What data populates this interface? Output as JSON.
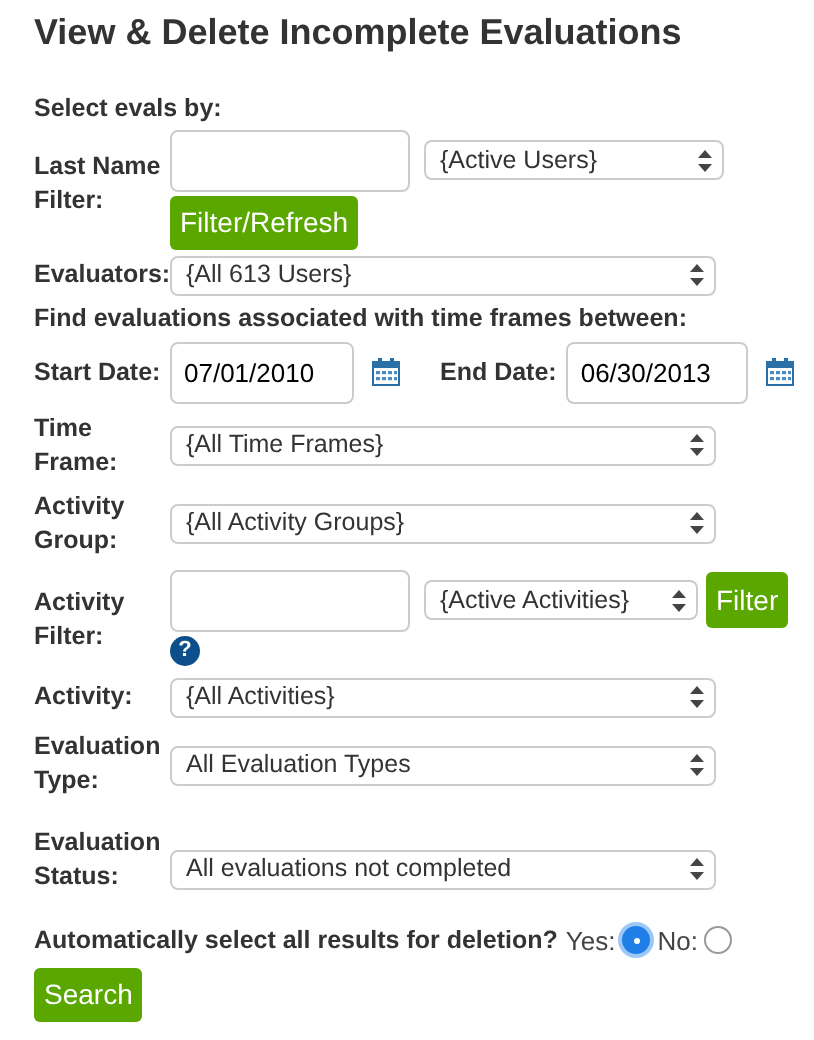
{
  "title": "View & Delete Incomplete Evaluations",
  "section_label": "Select evals by:",
  "last_name_filter": {
    "label": "Last Name Filter:",
    "users_select": "{Active Users}",
    "button": "Filter/Refresh"
  },
  "evaluators": {
    "label": "Evaluators:",
    "value": "{All 613 Users}"
  },
  "time_frame_heading": "Find evaluations associated with time frames between:",
  "start_date": {
    "label": "Start Date:",
    "value": "07/01/2010"
  },
  "end_date": {
    "label": "End Date:",
    "value": "06/30/2013"
  },
  "time_frame": {
    "label": "Time Frame:",
    "value": "{All Time Frames}"
  },
  "activity_group": {
    "label": "Activity Group:",
    "value": "{All Activity Groups}"
  },
  "activity_filter": {
    "label": "Activity Filter:",
    "select": "{Active Activities}",
    "button": "Filter",
    "help": "?"
  },
  "activity": {
    "label": "Activity:",
    "value": "{All Activities}"
  },
  "evaluation_type": {
    "label": "Evaluation Type:",
    "value": "All Evaluation Types"
  },
  "evaluation_status": {
    "label": "Evaluation Status:",
    "value": "All evaluations not completed"
  },
  "auto_select": {
    "question": "Automatically select all results for deletion?",
    "options": [
      {
        "label": "Yes:",
        "selected": true
      },
      {
        "label": "No:",
        "selected": false
      }
    ]
  },
  "search_button": "Search"
}
